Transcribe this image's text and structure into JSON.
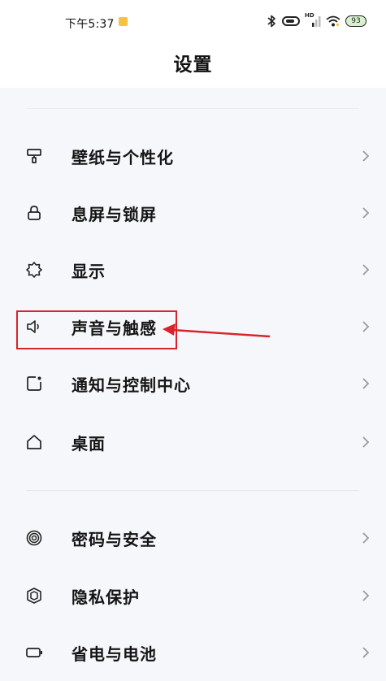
{
  "status_bar": {
    "time": "下午5:37",
    "hd_label": "HD",
    "battery_level": "93"
  },
  "header": {
    "title": "设置"
  },
  "settings_groups": [
    {
      "items": [
        {
          "label": "壁纸与个性化",
          "icon": "paint-roller-icon"
        },
        {
          "label": "息屏与锁屏",
          "icon": "lock-icon"
        },
        {
          "label": "显示",
          "icon": "brightness-icon"
        },
        {
          "label": "声音与触感",
          "icon": "speaker-icon"
        },
        {
          "label": "通知与控制中心",
          "icon": "notification-icon"
        },
        {
          "label": "桌面",
          "icon": "home-icon"
        }
      ]
    },
    {
      "items": [
        {
          "label": "密码与安全",
          "icon": "fingerprint-icon"
        },
        {
          "label": "隐私保护",
          "icon": "privacy-shield-icon"
        },
        {
          "label": "省电与电池",
          "icon": "battery-icon"
        }
      ]
    }
  ],
  "annotation": {
    "highlight_color": "#d9232a",
    "highlighted_item": "声音与触感"
  },
  "colors": {
    "background": "#f6f7fa",
    "header_background": "#ffffff",
    "text": "#151515",
    "chevron": "#9a9a9e"
  }
}
